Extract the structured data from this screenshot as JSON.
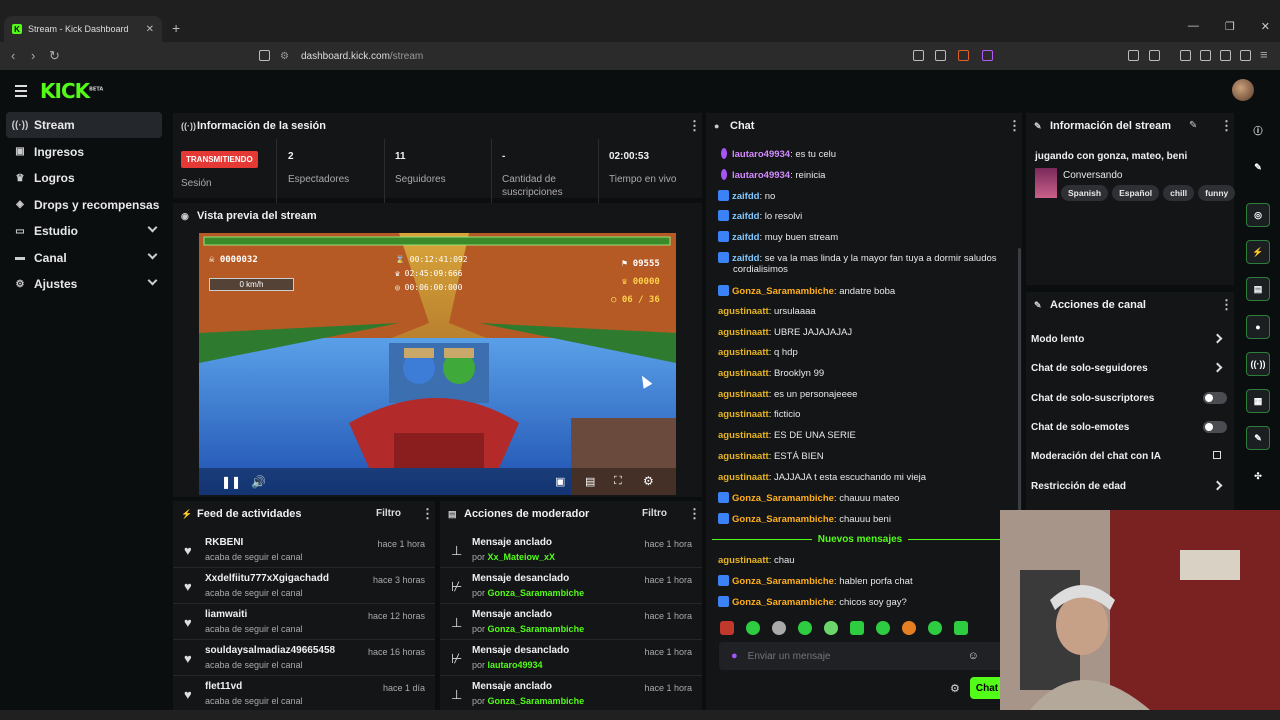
{
  "browser": {
    "tab_title": "Stream - Kick Dashboard",
    "url_domain": "dashboard.kick.com",
    "url_path": "/stream"
  },
  "logo": {
    "text": "KICK",
    "sup": "BETA"
  },
  "nav": [
    {
      "label": "Stream",
      "icon": "broadcast-icon",
      "active": true
    },
    {
      "label": "Ingresos",
      "icon": "money-icon"
    },
    {
      "label": "Logros",
      "icon": "trophy-icon"
    },
    {
      "label": "Drops y recompensas",
      "icon": "drops-icon"
    },
    {
      "label": "Estudio",
      "icon": "studio-icon",
      "chevron": true
    },
    {
      "label": "Canal",
      "icon": "channel-icon",
      "chevron": true
    },
    {
      "label": "Ajustes",
      "icon": "gear-icon",
      "chevron": true
    }
  ],
  "session": {
    "title": "Información de la sesión",
    "live_label": "TRANSMITIENDO",
    "session_label": "Sesión",
    "stats": [
      {
        "value": "2",
        "label": "Espectadores"
      },
      {
        "value": "11",
        "label": "Seguidores"
      },
      {
        "value": "-",
        "label": "Cantidad de suscripciones"
      },
      {
        "value": "02:00:53",
        "label": "Tiempo en vivo"
      }
    ]
  },
  "preview": {
    "title": "Vista previa del stream",
    "hud": {
      "score": "0000032",
      "speed": "0 km/h",
      "time1": "00:12:41:092",
      "time2": "02:45:09:666",
      "time3": "00:06:00:000",
      "flag_score": "09555",
      "crown_score": "00000",
      "coins": "06 / 36"
    }
  },
  "feed": {
    "title": "Feed de actividades",
    "filter": "Filtro",
    "items": [
      {
        "name": "RKBENI",
        "sub": "acaba de seguir el canal",
        "time": "hace 1 hora"
      },
      {
        "name": "Xxdelfiitu777xXgigachadd",
        "sub": "acaba de seguir el canal",
        "time": "hace 3 horas"
      },
      {
        "name": "liamwaiti",
        "sub": "acaba de seguir el canal",
        "time": "hace 12 horas"
      },
      {
        "name": "souldaysalmadiaz49665458",
        "sub": "acaba de seguir el canal",
        "time": "hace 16 horas"
      },
      {
        "name": "flet11vd",
        "sub": "acaba de seguir el canal",
        "time": "hace 1 día"
      }
    ]
  },
  "modactions": {
    "title": "Acciones de moderador",
    "filter": "Filtro",
    "by": "por",
    "items": [
      {
        "action": "Mensaje anclado",
        "user": "Xx_Mateiow_xX",
        "time": "hace 1 hora"
      },
      {
        "action": "Mensaje desanclado",
        "user": "Gonza_Saramambiche",
        "time": "hace 1 hora"
      },
      {
        "action": "Mensaje anclado",
        "user": "Gonza_Saramambiche",
        "time": "hace 1 hora"
      },
      {
        "action": "Mensaje desanclado",
        "user": "lautaro49934",
        "time": "hace 1 hora"
      },
      {
        "action": "Mensaje anclado",
        "user": "Gonza_Saramambiche",
        "time": "hace 1 hora"
      }
    ]
  },
  "chat": {
    "title": "Chat",
    "new_messages": "Nuevos mensajes",
    "placeholder": "Enviar un mensaje",
    "send_label": "Chat",
    "messages": [
      {
        "user": "lautaro49934",
        "text": "es tu celu",
        "color": "#d28aff",
        "badge": "mic"
      },
      {
        "user": "lautaro49934",
        "text": "reinicia",
        "color": "#d28aff",
        "badge": "mic"
      },
      {
        "user": "zaifdd",
        "text": "no",
        "color": "#7fc7ff",
        "badge": "blue"
      },
      {
        "user": "zaifdd",
        "text": "lo resolvi",
        "color": "#7fc7ff",
        "badge": "blue"
      },
      {
        "user": "zaifdd",
        "text": "muy buen stream",
        "color": "#7fc7ff",
        "badge": "blue"
      },
      {
        "user": "zaifdd",
        "text": "se va la mas linda y la mayor fan tuya a dormir saludos",
        "text2": "cordialisimos",
        "color": "#7fc7ff",
        "badge": "blue"
      },
      {
        "user": "Gonza_Saramambiche",
        "text": "andatre boba",
        "color": "#ffb020",
        "badge": "blue"
      },
      {
        "user": "agustinaatt",
        "text": "ursulaaaa",
        "color": "#e6b422"
      },
      {
        "user": "agustinaatt",
        "text": "UBRE JAJAJAJAJ",
        "color": "#e6b422"
      },
      {
        "user": "agustinaatt",
        "text": "q hdp",
        "color": "#e6b422"
      },
      {
        "user": "agustinaatt",
        "text": "Brooklyn 99",
        "color": "#e6b422"
      },
      {
        "user": "agustinaatt",
        "text": "es un personajeeee",
        "color": "#e6b422"
      },
      {
        "user": "agustinaatt",
        "text": "ficticio",
        "color": "#e6b422"
      },
      {
        "user": "agustinaatt",
        "text": "ES DE UNA SERIE",
        "color": "#e6b422"
      },
      {
        "user": "agustinaatt",
        "text": "ESTÁ BIEN",
        "color": "#e6b422"
      },
      {
        "user": "agustinaatt",
        "text": "JAJJAJA t esta escuchando mi vieja",
        "color": "#e6b422"
      },
      {
        "user": "Gonza_Saramambiche",
        "text": "chauuu mateo",
        "color": "#ffb020",
        "badge": "blue"
      },
      {
        "user": "Gonza_Saramambiche",
        "text": "chauuu beni",
        "color": "#ffb020",
        "badge": "blue"
      }
    ],
    "new_list": [
      {
        "user": "agustinaatt",
        "text": "chau",
        "color": "#e6b422"
      },
      {
        "user": "Gonza_Saramambiche",
        "text": "hablen porfa chat",
        "color": "#ffb020",
        "badge": "blue"
      },
      {
        "user": "Gonza_Saramambiche",
        "text": "chicos soy gay?",
        "color": "#ffb020",
        "badge": "blue"
      }
    ]
  },
  "streaminfo": {
    "title": "Información del stream",
    "stream_title": "jugando con gonza, mateo, beni",
    "category": "Conversando",
    "tags": [
      "Spanish",
      "Español",
      "chill",
      "funny"
    ]
  },
  "channelactions": {
    "title": "Acciones de canal",
    "items": [
      {
        "label": "Modo lento",
        "type": "arrow"
      },
      {
        "label": "Chat de solo-seguidores",
        "type": "arrow"
      },
      {
        "label": "Chat de solo-suscriptores",
        "type": "toggle"
      },
      {
        "label": "Chat de solo-emotes",
        "type": "toggle"
      },
      {
        "label": "Moderación del chat con IA",
        "type": "external"
      },
      {
        "label": "Restricción de edad",
        "type": "arrow"
      }
    ]
  },
  "colors": {
    "accent": "#53fc18",
    "live": "#e53935",
    "panel": "#141517",
    "bg": "#0b0e0f"
  }
}
